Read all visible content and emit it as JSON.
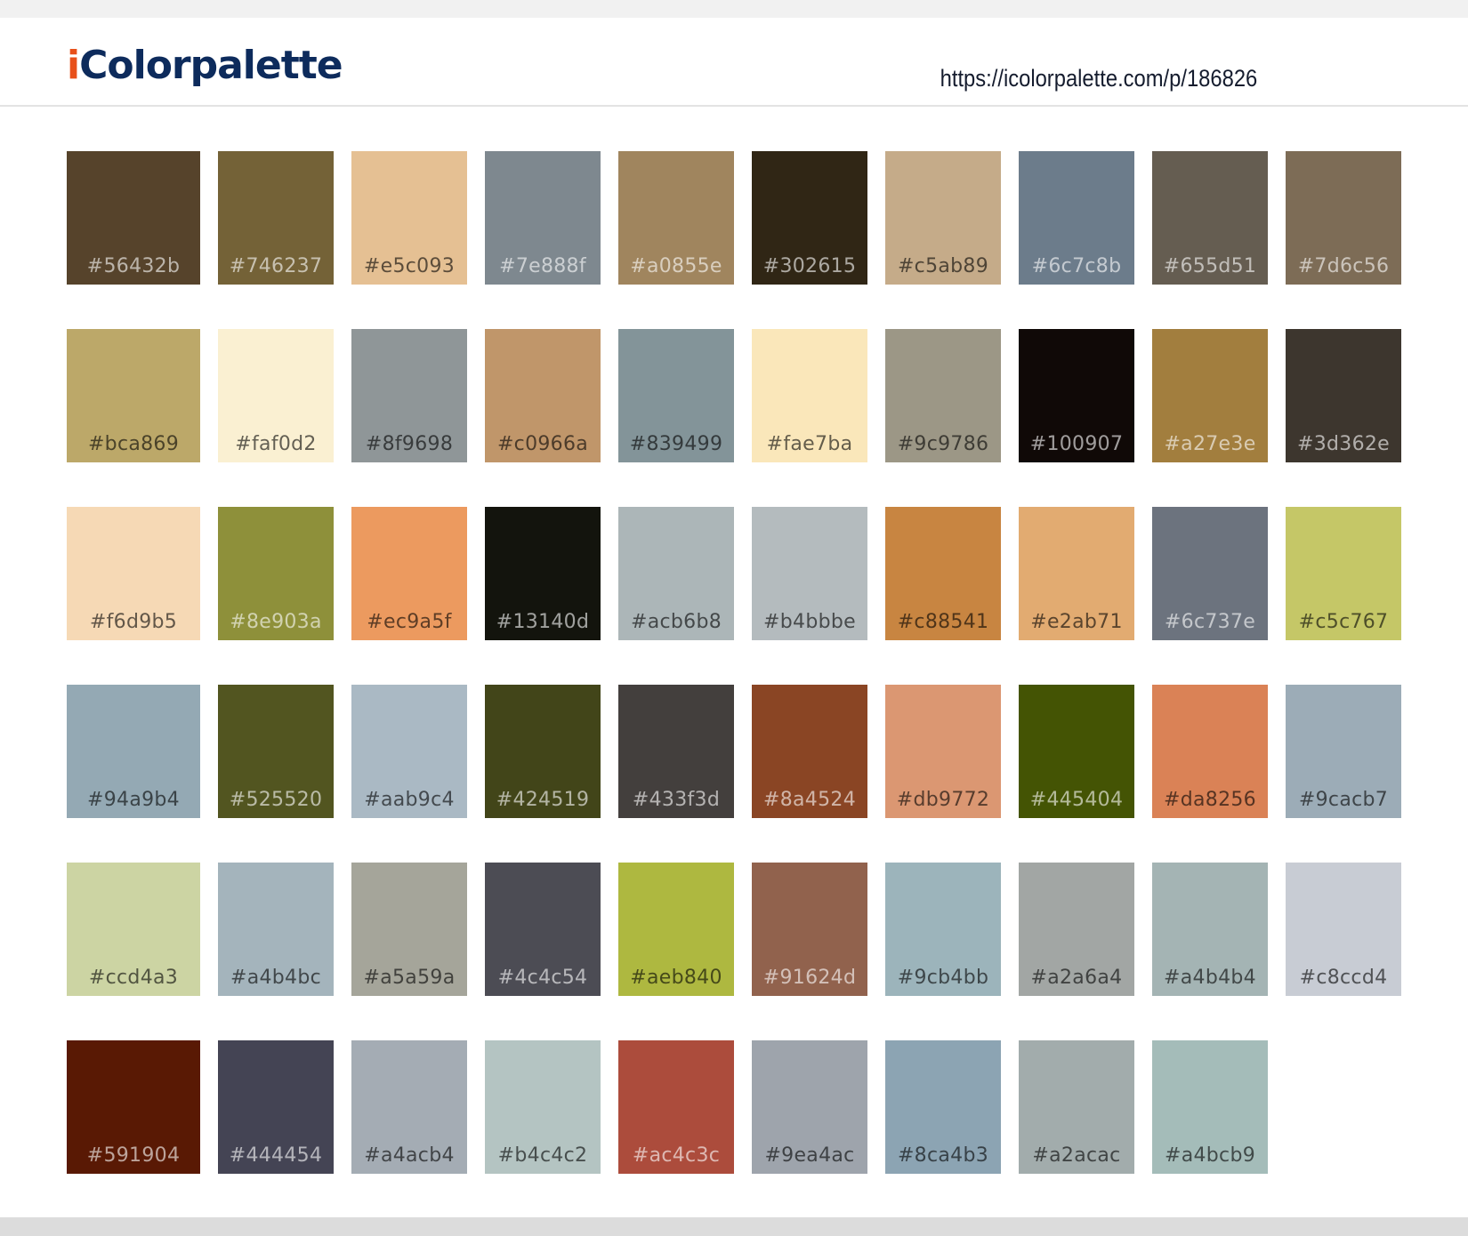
{
  "header": {
    "logo_prefix": "i",
    "logo_rest": "Colorpalette",
    "url": "https://icolorpalette.com/p/186826"
  },
  "swatches": [
    "#56432b",
    "#746237",
    "#e5c093",
    "#7e888f",
    "#a0855e",
    "#302615",
    "#c5ab89",
    "#6c7c8b",
    "#655d51",
    "#7d6c56",
    "#bca869",
    "#faf0d2",
    "#8f9698",
    "#c0966a",
    "#839499",
    "#fae7ba",
    "#9c9786",
    "#100907",
    "#a27e3e",
    "#3d362e",
    "#f6d9b5",
    "#8e903a",
    "#ec9a5f",
    "#13140d",
    "#acb6b8",
    "#b4bbbe",
    "#c88541",
    "#e2ab71",
    "#6c737e",
    "#c5c767",
    "#94a9b4",
    "#525520",
    "#aab9c4",
    "#424519",
    "#433f3d",
    "#8a4524",
    "#db9772",
    "#445404",
    "#da8256",
    "#9cacb7",
    "#ccd4a3",
    "#a4b4bc",
    "#a5a59a",
    "#4c4c54",
    "#aeb840",
    "#91624d",
    "#9cb4bb",
    "#a2a6a4",
    "#a4b4b4",
    "#c8ccd4",
    "#591904",
    "#444454",
    "#a4acb4",
    "#b4c4c2",
    "#ac4c3c",
    "#9ea4ac",
    "#8ca4b3",
    "#a2acac",
    "#a4bcb9"
  ]
}
